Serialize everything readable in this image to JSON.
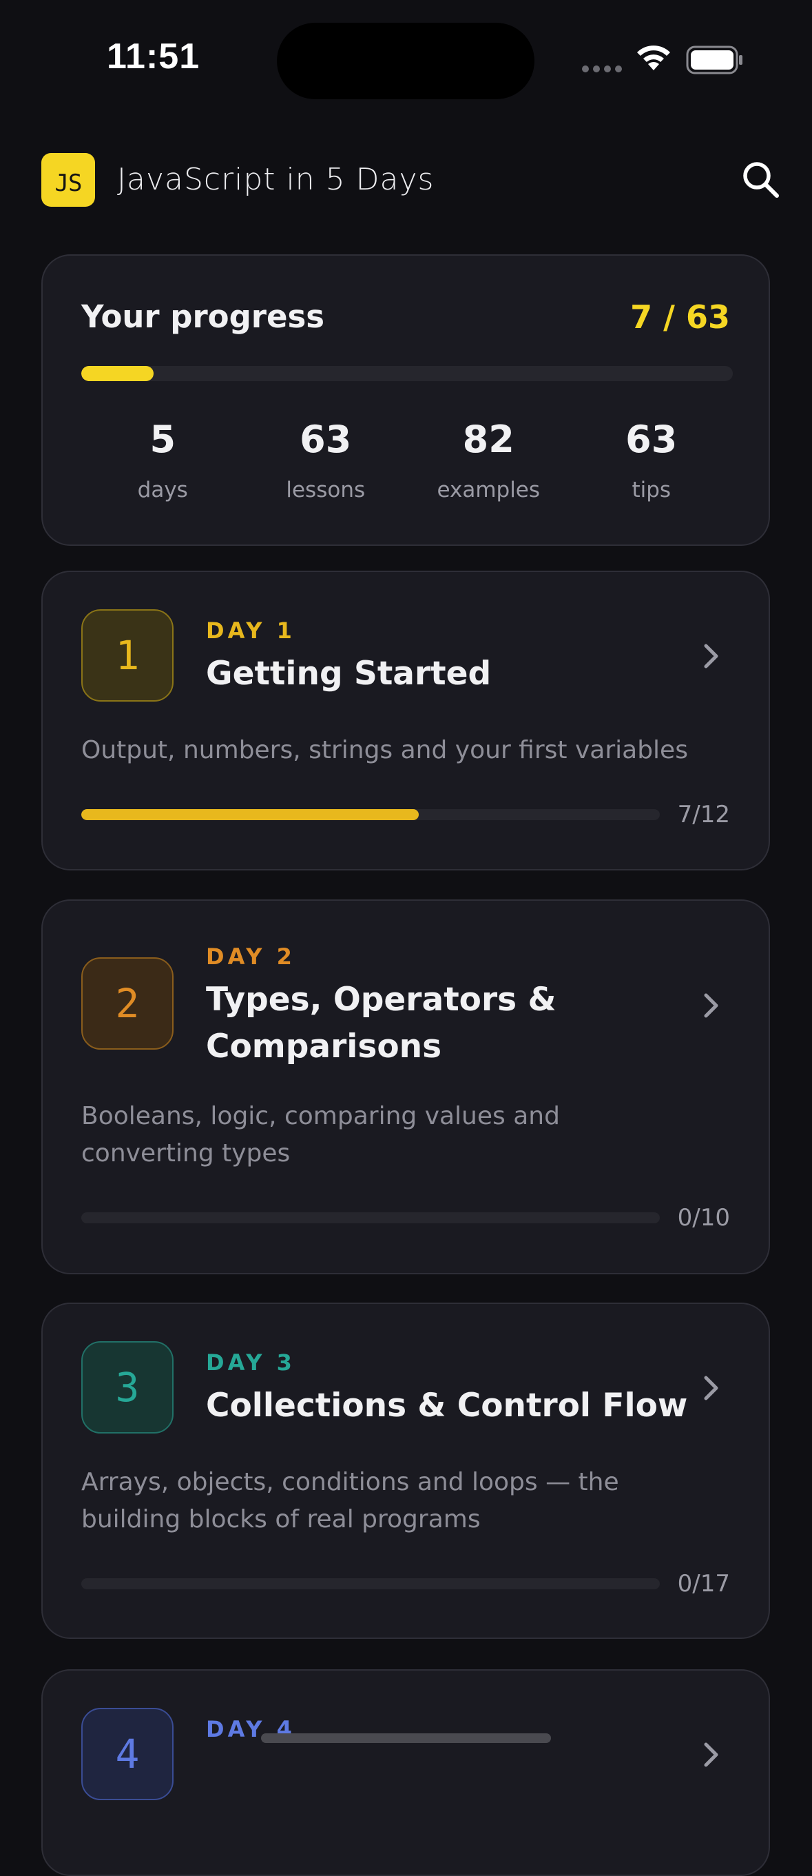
{
  "status_bar": {
    "time": "11:51"
  },
  "header": {
    "logo_text": "JS",
    "title": "JavaScript in 5 Days",
    "search_icon": "search-icon"
  },
  "progress": {
    "title": "Your progress",
    "count": "7 / 63",
    "completed_fraction": 0.111,
    "stats": [
      {
        "value": "5",
        "label": "days"
      },
      {
        "value": "63",
        "label": "lessons"
      },
      {
        "value": "82",
        "label": "examples"
      },
      {
        "value": "63",
        "label": "tips"
      }
    ]
  },
  "days": [
    {
      "number": "1",
      "label": "DAY 1",
      "title": "Getting Started",
      "description": "Output, numbers, strings and your first variables",
      "count": "7/12",
      "completed_fraction": 0.583,
      "accent": "#e8b81d"
    },
    {
      "number": "2",
      "label": "DAY 2",
      "title": "Types, Operators & Comparisons",
      "description": "Booleans, logic, comparing values and converting types",
      "count": "0/10",
      "completed_fraction": 0,
      "accent": "#e08c25"
    },
    {
      "number": "3",
      "label": "DAY 3",
      "title": "Collections & Control Flow",
      "description": "Arrays, objects, conditions and loops — the building blocks of real programs",
      "count": "0/17",
      "completed_fraction": 0,
      "accent": "#26a897"
    },
    {
      "number": "4",
      "label": "DAY 4",
      "accent": "#5e7ae3"
    }
  ],
  "colors": {
    "background": "#0f0f13",
    "card": "#1a1a21",
    "brand_yellow": "#f5d623"
  }
}
